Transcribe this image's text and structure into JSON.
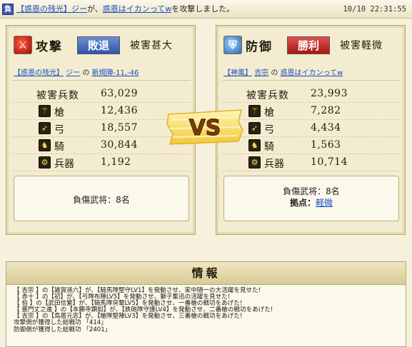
{
  "header": {
    "badge": "負",
    "guild": "【惑恩の残光】",
    "player": "ジー",
    "particle1": "が、",
    "target": "惑恩はイカンってw",
    "suffix": "を攻撃しました。",
    "timestamp": "10/10 22:31:55"
  },
  "attack": {
    "role": "攻撃",
    "result": "敗退",
    "damage_level": "被害甚大",
    "guild": "【惑恩の残光】",
    "player": "ジー",
    "particle": "の",
    "location": "新規陣-11,-46",
    "total_label": "被害兵数",
    "total_value": "63,029",
    "units": [
      {
        "icon": "spear",
        "label": "槍",
        "value": "12,436"
      },
      {
        "icon": "bow",
        "label": "弓",
        "value": "18,557"
      },
      {
        "icon": "horse",
        "label": "騎",
        "value": "30,844"
      },
      {
        "icon": "siege",
        "label": "兵器",
        "value": "1,192"
      }
    ],
    "injured": "負傷武将：8名"
  },
  "defense": {
    "role": "防御",
    "result": "勝利",
    "damage_level": "被害軽微",
    "guild": "【神風】",
    "player": "吉宗",
    "particle": "の",
    "location": "惑恩はイカンってw",
    "total_label": "被害兵数",
    "total_value": "23,993",
    "units": [
      {
        "icon": "spear",
        "label": "槍",
        "value": "7,282"
      },
      {
        "icon": "bow",
        "label": "弓",
        "value": "4,434"
      },
      {
        "icon": "horse",
        "label": "騎",
        "value": "1,563"
      },
      {
        "icon": "siege",
        "label": "兵器",
        "value": "10,714"
      }
    ],
    "injured": "負傷武将：8名",
    "base_label": "拠点：",
    "base_value": "軽微"
  },
  "vs": "VS",
  "info": {
    "title": "情報",
    "lines": [
      "【 吉宗 】の【雑賀孫六】が、【騎馬隊堅守LV1】を発動させ、家中随一の大活躍を見せた!",
      "【 赤十 】の【初】が、【弓隊布陣LV5】を発動させ、獅子奮迅の活躍を見せた!",
      "【 伯 】の【武田信繁】が、【騎馬隊突撃LV5】を発動させ、一番槍の戦功をあげた!",
      "【 亜門丈之進 】の【本願寺顕如】が、【鉄砲隊守護LV4】を発動させ、二番槍の戦功をあげた!",
      "【 吉宗 】の【鳥居元忠】が、【槍隊堅陣LV3】を発動させ、三番槍の戦功をあげた!",
      "攻撃側が獲得した総戦功 「414」",
      "防御側が獲得した総戦功 「2401」"
    ]
  }
}
